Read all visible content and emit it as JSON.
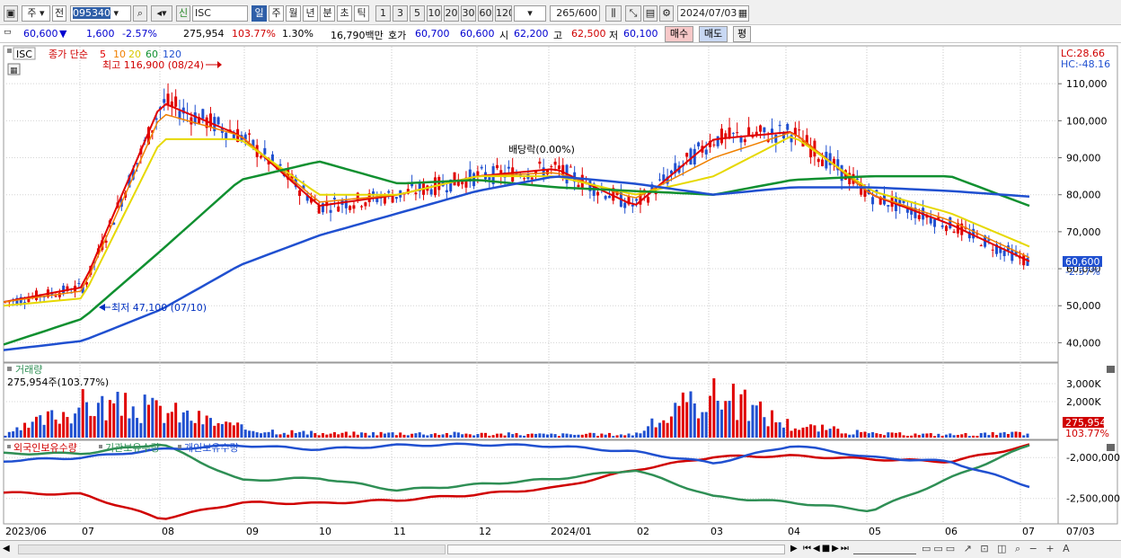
{
  "toolbar": {
    "type_main": "주",
    "type_sub": "전",
    "code": "095340",
    "name": "ISC",
    "shin_label": "신",
    "periods": [
      "일",
      "주",
      "월",
      "년",
      "분",
      "초",
      "틱"
    ],
    "intervals": [
      "1",
      "3",
      "5",
      "10",
      "20",
      "30",
      "60",
      "120"
    ],
    "count": "265",
    "count_total": "/600",
    "date": "2024/07/03"
  },
  "quote": {
    "price": "60,600",
    "change_arrow": "▼",
    "change": "1,600",
    "rate": "-2.57%",
    "volume": "275,954",
    "vol_rate": "103.77%",
    "turnover_rate": "1.30%",
    "amount": "16,790백만",
    "bid_label": "호가",
    "bid1": "60,700",
    "bid2": "60,600",
    "open_label": "시",
    "open": "62,200",
    "high_label": "고",
    "high": "62,500",
    "low_label": "저",
    "low": "60,100",
    "buy_label": "매수",
    "sell_label": "매도",
    "eval_label": "평"
  },
  "price_panel": {
    "legend_name": "ISC",
    "legend_text": "종가 단순",
    "ma_labels": [
      "5",
      "10",
      "20",
      "60",
      "120"
    ],
    "ma_colors": [
      "#e00000",
      "#f08000",
      "#e6d800",
      "#109030",
      "#2050d0"
    ],
    "high_note": "최고 116,900 (08/24)",
    "low_note": "최저 47,100 (07/10)",
    "dividend_note": "배당락(0.00%)",
    "lc": "LC:28.66",
    "hc": "HC:-48.16",
    "y_labels": [
      "110,000",
      "100,000",
      "90,000",
      "80,000",
      "70,000",
      "60,000",
      "50,000",
      "40,000"
    ],
    "current_label": "60,600",
    "current_rate": "-2.57%"
  },
  "volume_panel": {
    "title": "거래량",
    "value_line": "275,954주(103.77%)",
    "y_labels": [
      "3,000K",
      "2,000K",
      "1,000K"
    ],
    "current_label": "275,954",
    "current_rate": "103.77%"
  },
  "holding_panel": {
    "legend": [
      "외국인보유수량",
      "기관보유수량",
      "개인보유수량"
    ],
    "colors": [
      "#d00000",
      "#2f8f55",
      "#2050d0"
    ],
    "y_labels": [
      "-2,000,000",
      "-2,500,000"
    ]
  },
  "x_axis": [
    "2023/06",
    "07",
    "08",
    "09",
    "10",
    "11",
    "12",
    "2024/01",
    "02",
    "03",
    "04",
    "05",
    "06",
    "07",
    "07/03"
  ],
  "chart_data": [
    {
      "type": "line",
      "title": "",
      "x": [
        "2023/06",
        "07",
        "08",
        "09",
        "10",
        "11",
        "12",
        "2024/01",
        "02",
        "03",
        "04",
        "05",
        "06",
        "07"
      ],
      "series": [
        {
          "name": "5",
          "values": [
            51000,
            55000,
            105000,
            96000,
            77000,
            80000,
            85000,
            87000,
            77000,
            95000,
            97000,
            80000,
            72000,
            62000
          ]
        },
        {
          "name": "10",
          "values": [
            51000,
            54000,
            102000,
            96000,
            78000,
            80000,
            85000,
            86000,
            79000,
            90000,
            97000,
            80000,
            73000,
            63000
          ]
        },
        {
          "name": "20",
          "values": [
            50000,
            52000,
            95000,
            95000,
            80000,
            80000,
            85000,
            85000,
            80000,
            85000,
            96000,
            81000,
            75000,
            66000
          ]
        },
        {
          "name": "60",
          "values": [
            39500,
            46500,
            65000,
            84000,
            89000,
            83000,
            84000,
            82000,
            81000,
            80000,
            84000,
            85000,
            85000,
            77000
          ]
        },
        {
          "name": "120",
          "values": [
            38000,
            40500,
            49000,
            61000,
            69000,
            75000,
            81000,
            85000,
            83000,
            80000,
            82000,
            82000,
            81000,
            79500
          ]
        }
      ],
      "ylim": [
        35000,
        120000
      ]
    },
    {
      "type": "bar",
      "title": "거래량",
      "x": [
        "2023/06",
        "07",
        "08",
        "09",
        "10",
        "11",
        "12",
        "2024/01",
        "02",
        "03",
        "04",
        "05",
        "06",
        "07"
      ],
      "values_k": [
        150,
        2200,
        1800,
        600,
        250,
        300,
        250,
        200,
        220,
        3000,
        800,
        250,
        200,
        275.954
      ],
      "ylim": [
        0,
        3500
      ]
    },
    {
      "type": "line",
      "title": "",
      "x": [
        "2023/06",
        "07",
        "08",
        "09",
        "10",
        "11",
        "12",
        "2024/01",
        "02",
        "03",
        "04",
        "05",
        "06",
        "07"
      ],
      "series": [
        {
          "name": "외국인보유수량",
          "values": [
            -2430000,
            -2450000,
            -2750000,
            -2550000,
            -2560000,
            -2520000,
            -2450000,
            -2370000,
            -2150000,
            -1990000,
            -1980000,
            -2020000,
            -2050000,
            -1850000
          ]
        },
        {
          "name": "기관보유수량",
          "values": [
            -1950000,
            -1950000,
            -1830000,
            -2280000,
            -2250000,
            -2400000,
            -2330000,
            -2260000,
            -2150000,
            -2480000,
            -2550000,
            -2650000,
            -2250000,
            -1850000
          ]
        },
        {
          "name": "개인보유수량",
          "values": [
            -2040000,
            -2000000,
            -1900000,
            -1850000,
            -1900000,
            -1850000,
            -1840000,
            -1860000,
            -1930000,
            -2070000,
            -1850000,
            -2000000,
            -2050000,
            -2350000
          ]
        }
      ],
      "ylim": [
        -2800000,
        -1800000
      ]
    }
  ]
}
